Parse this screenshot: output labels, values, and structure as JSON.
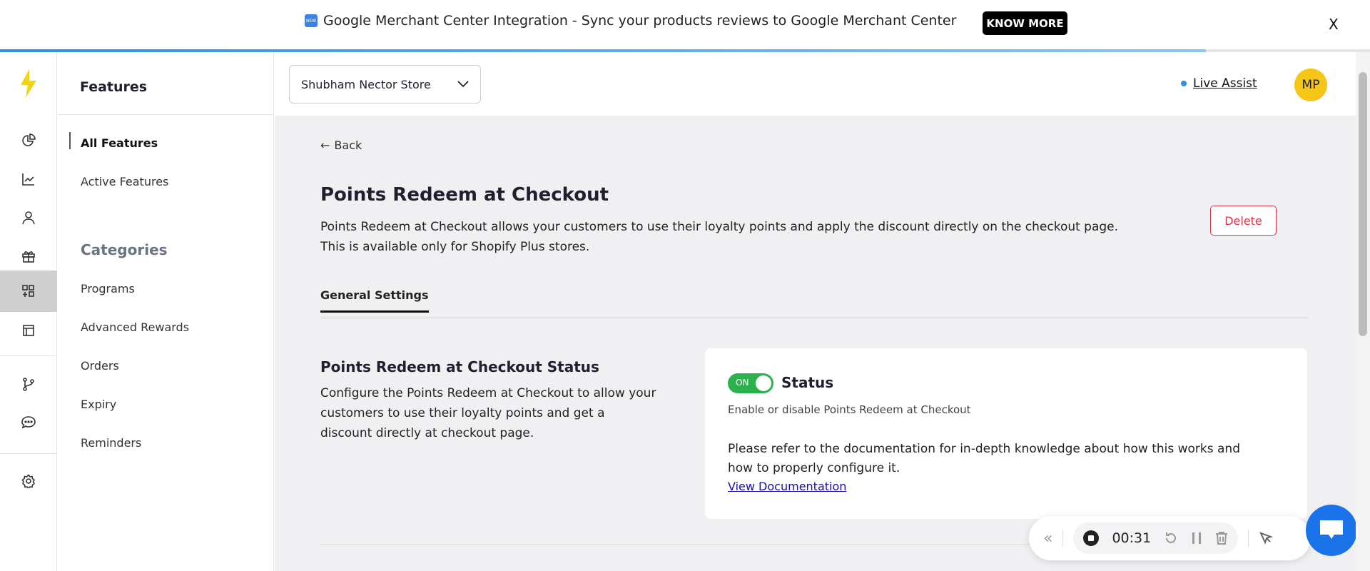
{
  "banner": {
    "badge": "NEW",
    "text": "Google Merchant Center Integration - Sync your products reviews to Google Merchant Center",
    "button": "KNOW MORE",
    "close": "X",
    "progress_percent": 88
  },
  "rail": {
    "items": [
      "dashboard",
      "analytics",
      "customers",
      "rewards",
      "features",
      "pages",
      "integrations",
      "messages",
      "settings"
    ]
  },
  "sidebar": {
    "title": "Features",
    "items": [
      "All Features",
      "Active Features"
    ],
    "categories_title": "Categories",
    "categories": [
      "Programs",
      "Advanced Rewards",
      "Orders",
      "Expiry",
      "Reminders"
    ]
  },
  "header": {
    "store": "Shubham Nector Store",
    "live_assist": "Live Assist",
    "avatar": "MP"
  },
  "page": {
    "back": "Back",
    "title": "Points Redeem at Checkout",
    "desc1": "Points Redeem at Checkout allows your customers to use their loyalty points and apply the discount directly on the checkout page.",
    "desc2": "This is available only for Shopify Plus stores.",
    "delete": "Delete",
    "tab": "General Settings"
  },
  "section": {
    "title": "Points Redeem at Checkout Status",
    "desc": [
      "Configure the Points Redeem at Checkout to allow your",
      "customers to use their loyalty points and get a",
      "discount directly at checkout page."
    ]
  },
  "card": {
    "toggle": "ON",
    "status": "Status",
    "status_desc": "Enable or disable Points Redeem at Checkout",
    "doc_text1": "Please refer to the documentation for in-depth knowledge about how this works and",
    "doc_text2": "how to properly configure it.",
    "doc_link": "View Documentation"
  },
  "recorder": {
    "collapse": "«",
    "time": "00:31"
  },
  "colors": {
    "accent": "#2f8fe6",
    "toggle_on": "#2bb24c",
    "delete": "#d9364a",
    "avatar": "#f5c518"
  }
}
